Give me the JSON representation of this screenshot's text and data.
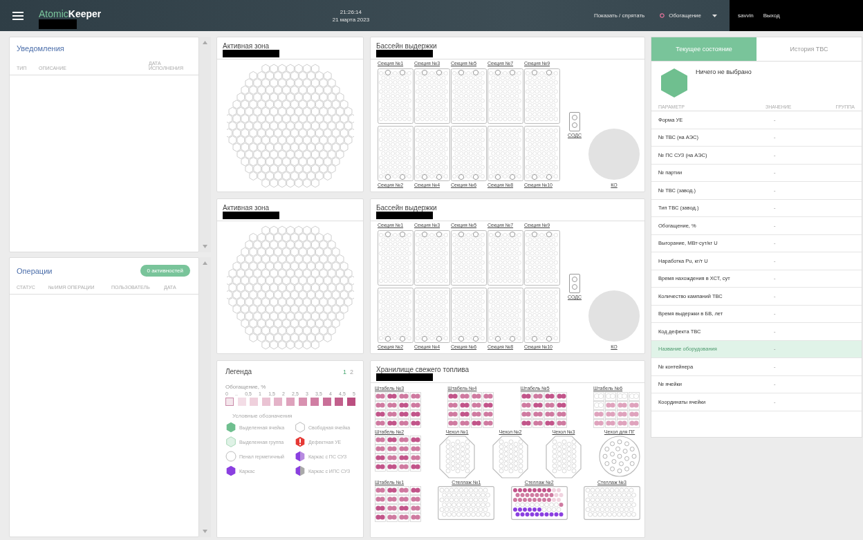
{
  "header": {
    "brand_light": "Atomic",
    "brand_bold": "Keeper",
    "time": "21:26:14",
    "date": "21 марта 2023",
    "toggle": "Показать / спрятать",
    "filter": "Обогащение",
    "user": "savvin",
    "logout": "Выход"
  },
  "notifications": {
    "title": "Уведомления",
    "columns": [
      "ТИП",
      "ОПИСАНИЕ",
      "ДАТА ИСПОЛНЕНИЯ"
    ]
  },
  "operations": {
    "title": "Операции",
    "badge": "0 активностей",
    "columns": [
      "СТАТУС",
      "№/ИМЯ ОПЕРАЦИИ",
      "ПОЛЬЗОВАТЕЛЬ",
      "ДАТА"
    ]
  },
  "core_panels": [
    {
      "title": "Активная зона"
    },
    {
      "title": "Активная зона"
    }
  ],
  "pool_panels": [
    {
      "title": "Бассейн выдержки",
      "sections_top": [
        "Секция №1",
        "Секция №3",
        "Секция №5",
        "Секция №7",
        "Секция №9"
      ],
      "sections_bottom": [
        "Секция №2",
        "Секция №4",
        "Секция №6",
        "Секция №8",
        "Секция №10"
      ],
      "sods": "СОДС",
      "ko": "КО"
    },
    {
      "title": "Бассейн выдержки",
      "sections_top": [
        "Секция №1",
        "Секция №3",
        "Секция №5",
        "Секция №7",
        "Секция №9"
      ],
      "sections_bottom": [
        "Секция №2",
        "Секция №4",
        "Секция №6",
        "Секция №8",
        "Секция №10"
      ],
      "sods": "СОДС",
      "ko": "КО"
    }
  ],
  "legend": {
    "title": "Легенда",
    "pages": [
      {
        "label": "1",
        "selected": true
      },
      {
        "label": "2",
        "selected": false
      }
    ],
    "scale_title": "Обогащение, %",
    "ticks": [
      "0",
      "..",
      "0,5",
      "1",
      "1,5",
      "2",
      "2,5",
      "3",
      "3,5",
      "4",
      "4,5",
      "5"
    ],
    "swatches": [
      {
        "color": "#f4e6ec"
      },
      {
        "color": "#f3dde6"
      },
      {
        "color": "#efd0dc"
      },
      {
        "color": "#eac3d3"
      },
      {
        "color": "#e4b3c8"
      },
      {
        "color": "#dea2bc"
      },
      {
        "color": "#d891b0"
      },
      {
        "color": "#d07ea3"
      },
      {
        "color": "#c96f98"
      },
      {
        "color": "#c2608c"
      },
      {
        "color": "#bb4f80"
      }
    ],
    "symbols_title": "Условные обозначения",
    "symbols": [
      {
        "kind": "selected-cell",
        "label": "Выделенная ячейка"
      },
      {
        "kind": "free-cell",
        "label": "Свободная ячейка"
      },
      {
        "kind": "selected-group",
        "label": "Выделенная группа"
      },
      {
        "kind": "defect",
        "label": "Дефектная УЕ"
      },
      {
        "kind": "sealed-case",
        "label": "Пенал герметичный"
      },
      {
        "kind": "frame-ps",
        "label": "Каркас с ПС СУЗ"
      },
      {
        "kind": "frame",
        "label": "Каркас"
      },
      {
        "kind": "frame-ips",
        "label": "Каркас с ИПС СУЗ"
      }
    ]
  },
  "storage": {
    "title": "Хранилище свежего топлива",
    "rows": [
      [
        {
          "kind": "stack",
          "label": "Штабель №3"
        },
        {
          "kind": "stack",
          "label": "Штабель №4"
        },
        {
          "kind": "stack",
          "label": "Штабель №5"
        },
        {
          "kind": "stack",
          "label": "Штабель №6"
        }
      ],
      [
        {
          "kind": "stack",
          "label": "Штабель №2"
        },
        {
          "kind": "case",
          "label": "Чехол №1"
        },
        {
          "kind": "case",
          "label": "Чехол №2"
        },
        {
          "kind": "case",
          "label": "Чехол №3"
        },
        {
          "kind": "round-case",
          "label": "Чехол для ПГ"
        }
      ],
      [
        {
          "kind": "stack",
          "label": "Штабель №1"
        },
        {
          "kind": "rack",
          "label": "Стеллаж №1"
        },
        {
          "kind": "rack",
          "label": "Стеллаж №2"
        },
        {
          "kind": "rack",
          "label": "Стеллаж №3"
        }
      ]
    ]
  },
  "details": {
    "tabs": [
      {
        "label": "Текущее состояние",
        "selected": true
      },
      {
        "label": "История ТВС",
        "selected": false
      }
    ],
    "empty_text": "Ничего не выбрано",
    "columns": [
      "ПАРАМЕТР",
      "ЗНАЧЕНИЕ",
      "ГРУППА"
    ],
    "rows": [
      {
        "param": "Форма УЕ",
        "value": "-",
        "selected": false
      },
      {
        "param": "№ ТВС (на АЭС)",
        "value": "-",
        "selected": false
      },
      {
        "param": "№ ПС СУЗ (на АЭС)",
        "value": "-",
        "selected": false
      },
      {
        "param": "№ партии",
        "value": "-",
        "selected": false
      },
      {
        "param": "№ ТВС (завод.)",
        "value": "-",
        "selected": false
      },
      {
        "param": "Тип ТВС (завод.)",
        "value": "-",
        "selected": false
      },
      {
        "param": "Обогащение, %",
        "value": "-",
        "selected": false
      },
      {
        "param": "Выгорание, МВт·сут/кг U",
        "value": "-",
        "selected": false
      },
      {
        "param": "Наработка Pu, кг/т U",
        "value": "-",
        "selected": false
      },
      {
        "param": "Время нахождения в ХСТ, сут",
        "value": "-",
        "selected": false
      },
      {
        "param": "Количество кампаний ТВС",
        "value": "-",
        "selected": false
      },
      {
        "param": "Время выдержки в БВ, лет",
        "value": "-",
        "selected": false
      },
      {
        "param": "Код дефекта ТВС",
        "value": "-",
        "selected": false
      },
      {
        "param": "Название оборудования",
        "value": "-",
        "selected": true
      },
      {
        "param": "№ контейнера",
        "value": "-",
        "selected": false
      },
      {
        "param": "№ ячейки",
        "value": "-",
        "selected": false
      },
      {
        "param": "Координаты ячейки",
        "value": "-",
        "selected": false
      }
    ]
  }
}
